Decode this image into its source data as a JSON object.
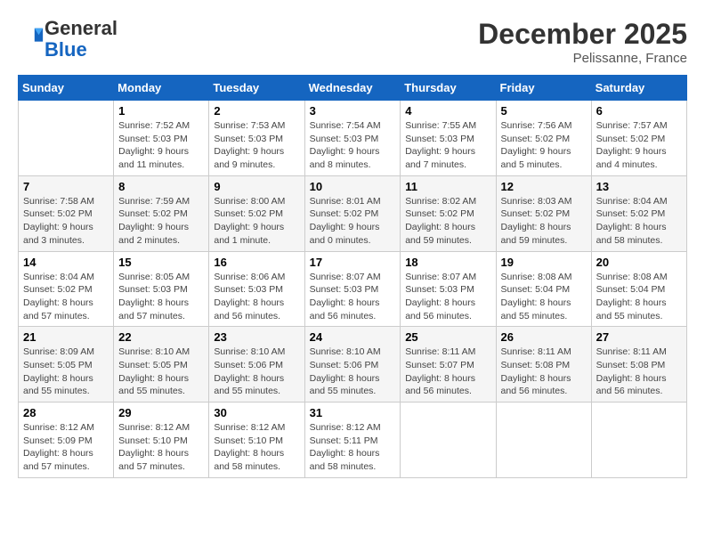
{
  "header": {
    "logo": {
      "line1": "General",
      "line2": "Blue"
    },
    "title": "December 2025",
    "location": "Pelissanne, France"
  },
  "days_of_week": [
    "Sunday",
    "Monday",
    "Tuesday",
    "Wednesday",
    "Thursday",
    "Friday",
    "Saturday"
  ],
  "weeks": [
    [
      {
        "day": "",
        "info": ""
      },
      {
        "day": "1",
        "info": "Sunrise: 7:52 AM\nSunset: 5:03 PM\nDaylight: 9 hours\nand 11 minutes."
      },
      {
        "day": "2",
        "info": "Sunrise: 7:53 AM\nSunset: 5:03 PM\nDaylight: 9 hours\nand 9 minutes."
      },
      {
        "day": "3",
        "info": "Sunrise: 7:54 AM\nSunset: 5:03 PM\nDaylight: 9 hours\nand 8 minutes."
      },
      {
        "day": "4",
        "info": "Sunrise: 7:55 AM\nSunset: 5:03 PM\nDaylight: 9 hours\nand 7 minutes."
      },
      {
        "day": "5",
        "info": "Sunrise: 7:56 AM\nSunset: 5:02 PM\nDaylight: 9 hours\nand 5 minutes."
      },
      {
        "day": "6",
        "info": "Sunrise: 7:57 AM\nSunset: 5:02 PM\nDaylight: 9 hours\nand 4 minutes."
      }
    ],
    [
      {
        "day": "7",
        "info": "Sunrise: 7:58 AM\nSunset: 5:02 PM\nDaylight: 9 hours\nand 3 minutes."
      },
      {
        "day": "8",
        "info": "Sunrise: 7:59 AM\nSunset: 5:02 PM\nDaylight: 9 hours\nand 2 minutes."
      },
      {
        "day": "9",
        "info": "Sunrise: 8:00 AM\nSunset: 5:02 PM\nDaylight: 9 hours\nand 1 minute."
      },
      {
        "day": "10",
        "info": "Sunrise: 8:01 AM\nSunset: 5:02 PM\nDaylight: 9 hours\nand 0 minutes."
      },
      {
        "day": "11",
        "info": "Sunrise: 8:02 AM\nSunset: 5:02 PM\nDaylight: 8 hours\nand 59 minutes."
      },
      {
        "day": "12",
        "info": "Sunrise: 8:03 AM\nSunset: 5:02 PM\nDaylight: 8 hours\nand 59 minutes."
      },
      {
        "day": "13",
        "info": "Sunrise: 8:04 AM\nSunset: 5:02 PM\nDaylight: 8 hours\nand 58 minutes."
      }
    ],
    [
      {
        "day": "14",
        "info": "Sunrise: 8:04 AM\nSunset: 5:02 PM\nDaylight: 8 hours\nand 57 minutes."
      },
      {
        "day": "15",
        "info": "Sunrise: 8:05 AM\nSunset: 5:03 PM\nDaylight: 8 hours\nand 57 minutes."
      },
      {
        "day": "16",
        "info": "Sunrise: 8:06 AM\nSunset: 5:03 PM\nDaylight: 8 hours\nand 56 minutes."
      },
      {
        "day": "17",
        "info": "Sunrise: 8:07 AM\nSunset: 5:03 PM\nDaylight: 8 hours\nand 56 minutes."
      },
      {
        "day": "18",
        "info": "Sunrise: 8:07 AM\nSunset: 5:03 PM\nDaylight: 8 hours\nand 56 minutes."
      },
      {
        "day": "19",
        "info": "Sunrise: 8:08 AM\nSunset: 5:04 PM\nDaylight: 8 hours\nand 55 minutes."
      },
      {
        "day": "20",
        "info": "Sunrise: 8:08 AM\nSunset: 5:04 PM\nDaylight: 8 hours\nand 55 minutes."
      }
    ],
    [
      {
        "day": "21",
        "info": "Sunrise: 8:09 AM\nSunset: 5:05 PM\nDaylight: 8 hours\nand 55 minutes."
      },
      {
        "day": "22",
        "info": "Sunrise: 8:10 AM\nSunset: 5:05 PM\nDaylight: 8 hours\nand 55 minutes."
      },
      {
        "day": "23",
        "info": "Sunrise: 8:10 AM\nSunset: 5:06 PM\nDaylight: 8 hours\nand 55 minutes."
      },
      {
        "day": "24",
        "info": "Sunrise: 8:10 AM\nSunset: 5:06 PM\nDaylight: 8 hours\nand 55 minutes."
      },
      {
        "day": "25",
        "info": "Sunrise: 8:11 AM\nSunset: 5:07 PM\nDaylight: 8 hours\nand 56 minutes."
      },
      {
        "day": "26",
        "info": "Sunrise: 8:11 AM\nSunset: 5:08 PM\nDaylight: 8 hours\nand 56 minutes."
      },
      {
        "day": "27",
        "info": "Sunrise: 8:11 AM\nSunset: 5:08 PM\nDaylight: 8 hours\nand 56 minutes."
      }
    ],
    [
      {
        "day": "28",
        "info": "Sunrise: 8:12 AM\nSunset: 5:09 PM\nDaylight: 8 hours\nand 57 minutes."
      },
      {
        "day": "29",
        "info": "Sunrise: 8:12 AM\nSunset: 5:10 PM\nDaylight: 8 hours\nand 57 minutes."
      },
      {
        "day": "30",
        "info": "Sunrise: 8:12 AM\nSunset: 5:10 PM\nDaylight: 8 hours\nand 58 minutes."
      },
      {
        "day": "31",
        "info": "Sunrise: 8:12 AM\nSunset: 5:11 PM\nDaylight: 8 hours\nand 58 minutes."
      },
      {
        "day": "",
        "info": ""
      },
      {
        "day": "",
        "info": ""
      },
      {
        "day": "",
        "info": ""
      }
    ]
  ]
}
